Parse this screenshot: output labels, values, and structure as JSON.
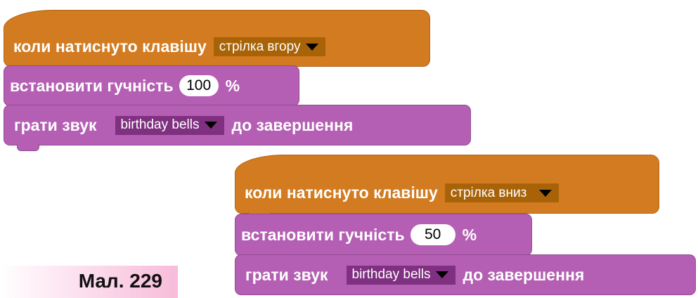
{
  "script1": {
    "hat": {
      "label": "коли натиснуто клавішу",
      "key": "стрілка вгору"
    },
    "volume": {
      "label": "встановити гучність",
      "value": "100",
      "unit": "%"
    },
    "sound": {
      "label": "грати звук",
      "sound": "birthday bells",
      "suffix": "до завершення"
    }
  },
  "script2": {
    "hat": {
      "label": "коли натиснуто клавішу",
      "key": "стрілка вниз"
    },
    "volume": {
      "label": "встановити гучність",
      "value": "50",
      "unit": "%"
    },
    "sound": {
      "label": "грати звук",
      "sound": "birthday bells",
      "suffix": "до завершення"
    }
  },
  "caption": "Мал. 229",
  "colors": {
    "events_block": "#d27b20",
    "sound_block": "#b45fb3",
    "key_dropdown": "#a86308",
    "sound_dropdown": "#7f3080"
  },
  "icons": {
    "dropdown": "triangle-down-icon"
  }
}
